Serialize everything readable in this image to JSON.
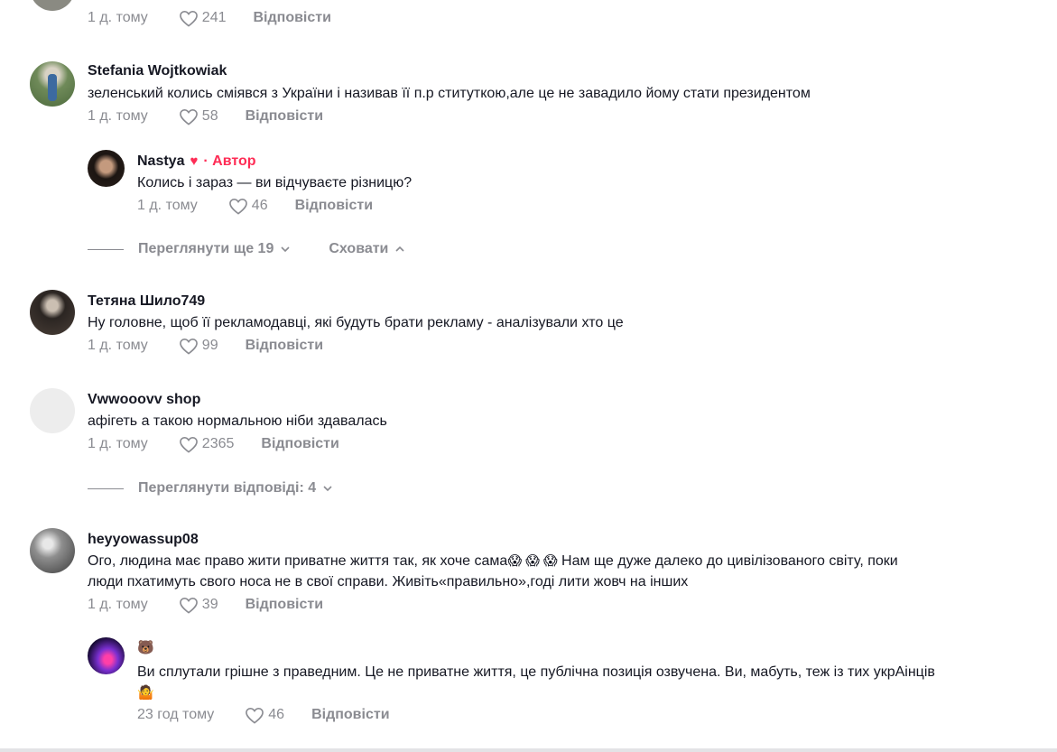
{
  "top_partial": {
    "time": "1 д. тому",
    "likes": "241",
    "reply": "Відповісти"
  },
  "comments": [
    {
      "user": "Stefania Wojtkowiak",
      "text": "зеленський колись сміявся з України і називав її п.р ституткою,але це не завадило йому стати президентом",
      "time": "1 д. тому",
      "likes": "58",
      "reply": "Відповісти"
    },
    {
      "user": "Nastya",
      "author_badge": "· Автор",
      "text": "Колись і зараз — ви відчуваєте різницю?",
      "time": "1 д. тому",
      "likes": "46",
      "reply": "Відповісти"
    },
    {
      "user": "Тетяна Шило749",
      "text": "Ну головне, щоб її рекламодавці, які будуть брати рекламу - аналізували хто це",
      "time": "1 д. тому",
      "likes": "99",
      "reply": "Відповісти"
    },
    {
      "user": "Vwwooovv shop",
      "text": "афігеть а такою нормальною ніби здавалась",
      "time": "1 д. тому",
      "likes": "2365",
      "reply": "Відповісти"
    },
    {
      "user": "heyyowassup08",
      "text_line1": "Ого, людина має право жити приватне життя так, як хоче сама",
      "text_line1b": "Нам ще дуже далеко до цивілізованого світу, поки",
      "text_line2": "люди пхатимуть свого носа не в свої справи. Живіть«правильно»,годі лити жовч на інших",
      "time": "1 д. тому",
      "likes": "39",
      "reply": "Відповісти"
    },
    {
      "user": "",
      "text": "Ви сплутали грішне з праведним. Це не приватне життя, це публічна позиція озвучена. Ви, мабуть, теж із тих укрАінців",
      "time": "23 год тому",
      "likes": "46",
      "reply": "Відповісти"
    }
  ],
  "thread_controls": {
    "view_more": "Переглянути ще 19",
    "hide": "Сховати",
    "view_replies": "Переглянути відповіді: 4"
  }
}
